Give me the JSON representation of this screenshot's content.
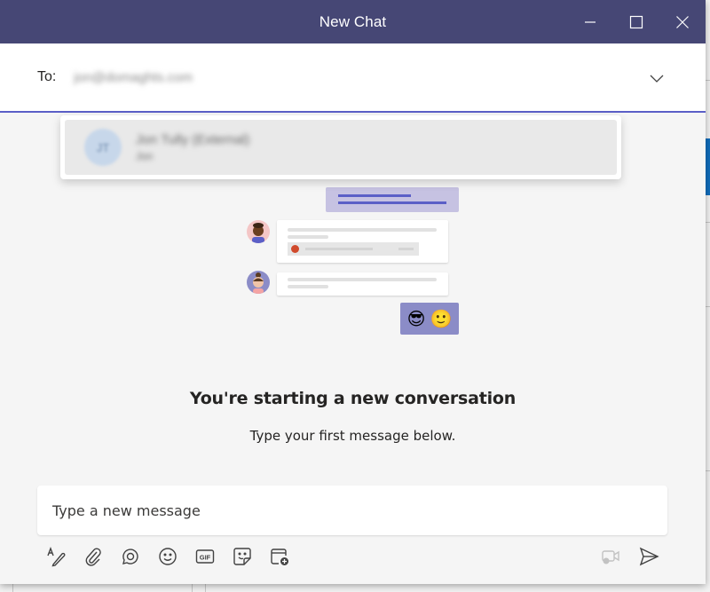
{
  "window": {
    "title": "New Chat",
    "controls": {
      "minimize": "minimize-icon",
      "maximize": "maximize-icon",
      "close": "close-icon"
    },
    "accent_color": "#464775"
  },
  "recipient": {
    "label": "To:",
    "value": "jon@domaghts.com",
    "dropdown_icon": "chevron-down-icon"
  },
  "suggestion": {
    "avatar_initials": "JT",
    "name": "Jon Tully (External)",
    "subtitle": "Jon"
  },
  "empty_state": {
    "title": "You're starting a new conversation",
    "subtitle": "Type your first message below.",
    "emojis": [
      "😎",
      "🙂"
    ]
  },
  "composer": {
    "placeholder": "Type a new message",
    "value": "",
    "tools": [
      {
        "name": "format",
        "icon": "format-icon"
      },
      {
        "name": "attach",
        "icon": "paperclip-icon"
      },
      {
        "name": "loop",
        "icon": "loop-icon"
      },
      {
        "name": "emoji",
        "icon": "emoji-icon"
      },
      {
        "name": "gif",
        "icon": "gif-icon",
        "label": "GIF"
      },
      {
        "name": "sticker",
        "icon": "sticker-icon"
      },
      {
        "name": "schedule-meeting",
        "icon": "schedule-meeting-icon"
      }
    ],
    "meet_now_icon": "video-chat-icon",
    "send_icon": "send-icon"
  }
}
